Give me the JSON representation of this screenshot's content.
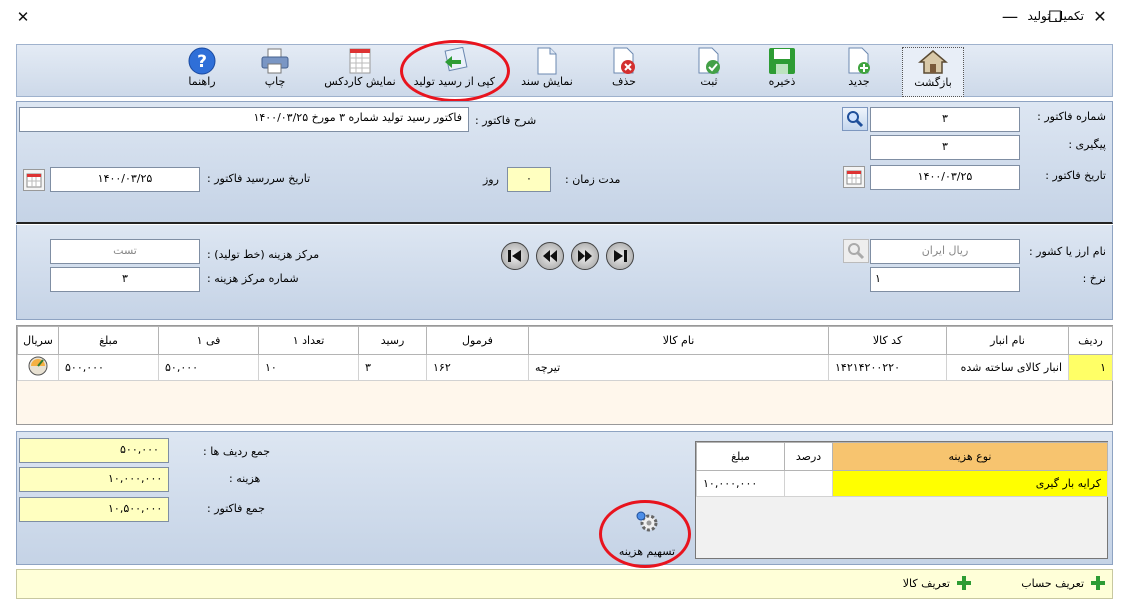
{
  "window": {
    "title": "تکمیل تولید",
    "minimize": "—",
    "maximize": "☐",
    "close": "✕"
  },
  "toolbar": {
    "back": "بازگشت",
    "new": "جدید",
    "save": "ذخیره",
    "confirm": "ثبت",
    "delete": "حذف",
    "show_document": "نمایش سند",
    "copy_from_receipt": "کپی از رسید تولید",
    "show_cardex": "نمایش کاردکس",
    "print": "چاپ",
    "help": "راهنما"
  },
  "header": {
    "invoice_number_label": "شماره فاکتور :",
    "invoice_number": "۳",
    "tracking_label": "پیگیری :",
    "tracking": "۳",
    "invoice_date_label": "تاریخ فاکتور :",
    "invoice_date": "۱۴۰۰/۰۳/۲۵",
    "description_label": "شرح فاکتور :",
    "description": "فاکتور رسید تولید شماره ۳ مورخ ۱۴۰۰/۰۳/۲۵",
    "duration_label": "مدت زمان :",
    "duration": "۰",
    "duration_unit": "روز",
    "due_date_label": "تاریخ سررسید فاکتور :",
    "due_date": "۱۴۰۰/۰۳/۲۵"
  },
  "currency": {
    "currency_label": "نام ارز یا کشور :",
    "currency": "ریال ایران",
    "rate_label": "نرخ :",
    "rate": "۱",
    "cost_center_label": "مرکز هزینه (خط تولید) :",
    "cost_center": "تست",
    "cost_center_no_label": "شماره مرکز هزینه :",
    "cost_center_no": "۳"
  },
  "items_table": {
    "columns": [
      "ردیف",
      "نام انبار",
      "کد کالا",
      "نام کالا",
      "فرمول",
      "رسید",
      "تعداد ۱",
      "فی ۱",
      "مبلغ",
      "سریال"
    ],
    "rows": [
      [
        "۱",
        "انبار کالای ساخته شده",
        "۱۴۲۱۴۲۰۰۲۲۰",
        "تیرچه",
        "۱۶۲",
        "۳",
        "۱۰",
        "۵۰,۰۰۰",
        "۵۰۰,۰۰۰"
      ]
    ]
  },
  "totals": {
    "rows_total_label": "جمع ردیف ها :",
    "rows_total": "۵۰۰,۰۰۰",
    "cost_label": "هزینه :",
    "cost": "۱۰,۰۰۰,۰۰۰",
    "invoice_total_label": "جمع فاکتور :",
    "invoice_total": "۱۰,۵۰۰,۰۰۰"
  },
  "allocate_button": "تسهیم هزینه",
  "cost_table": {
    "columns": [
      "نوع هزینه",
      "درصد",
      "مبلغ"
    ],
    "rows": [
      [
        "کرایه بار گیری",
        "",
        "۱۰,۰۰۰,۰۰۰"
      ]
    ]
  },
  "footer": {
    "define_account": "تعریف حساب",
    "define_product": "تعریف کالا"
  }
}
